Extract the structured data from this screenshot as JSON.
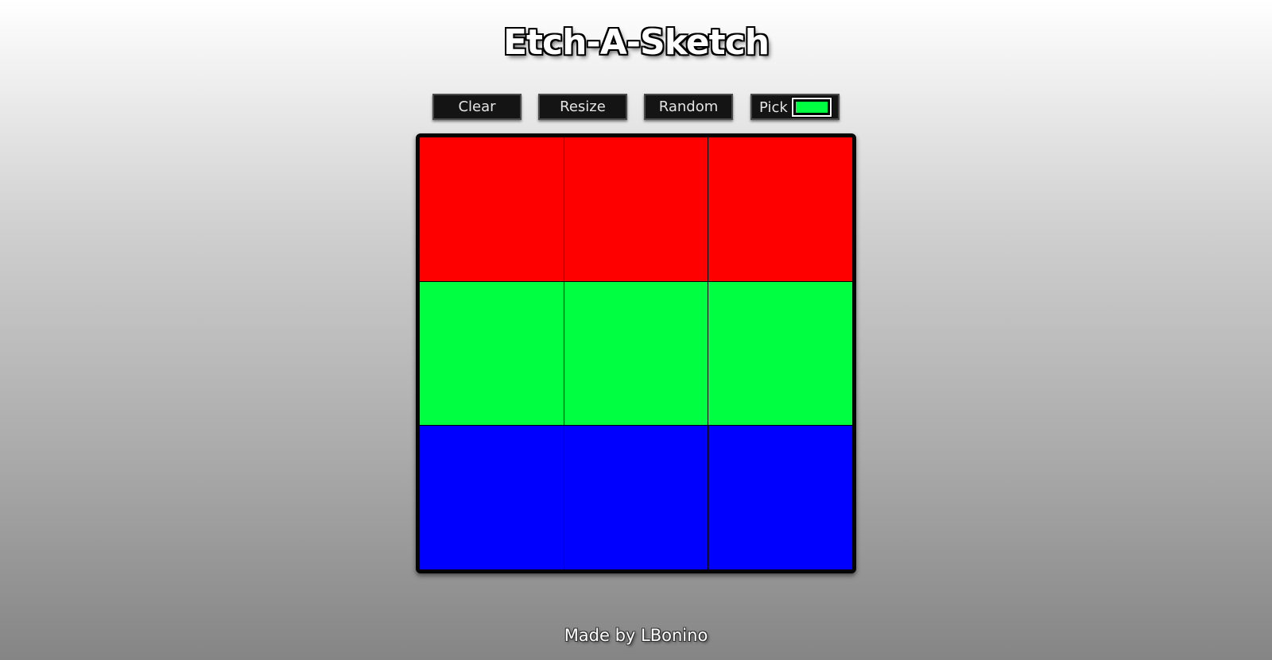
{
  "header": {
    "title": "Etch-A-Sketch"
  },
  "controls": {
    "clear_label": "Clear",
    "resize_label": "Resize",
    "random_label": "Random",
    "pick_label": "Pick",
    "picked_color": "#00ff41"
  },
  "grid": {
    "size": 3,
    "cells": [
      "#ff0000",
      "#ff0000",
      "#ff0000",
      "#00ff41",
      "#00ff41",
      "#00ff41",
      "#0000ff",
      "#0000ff",
      "#0000ff"
    ]
  },
  "footer": {
    "credit": "Made by LBonino"
  }
}
